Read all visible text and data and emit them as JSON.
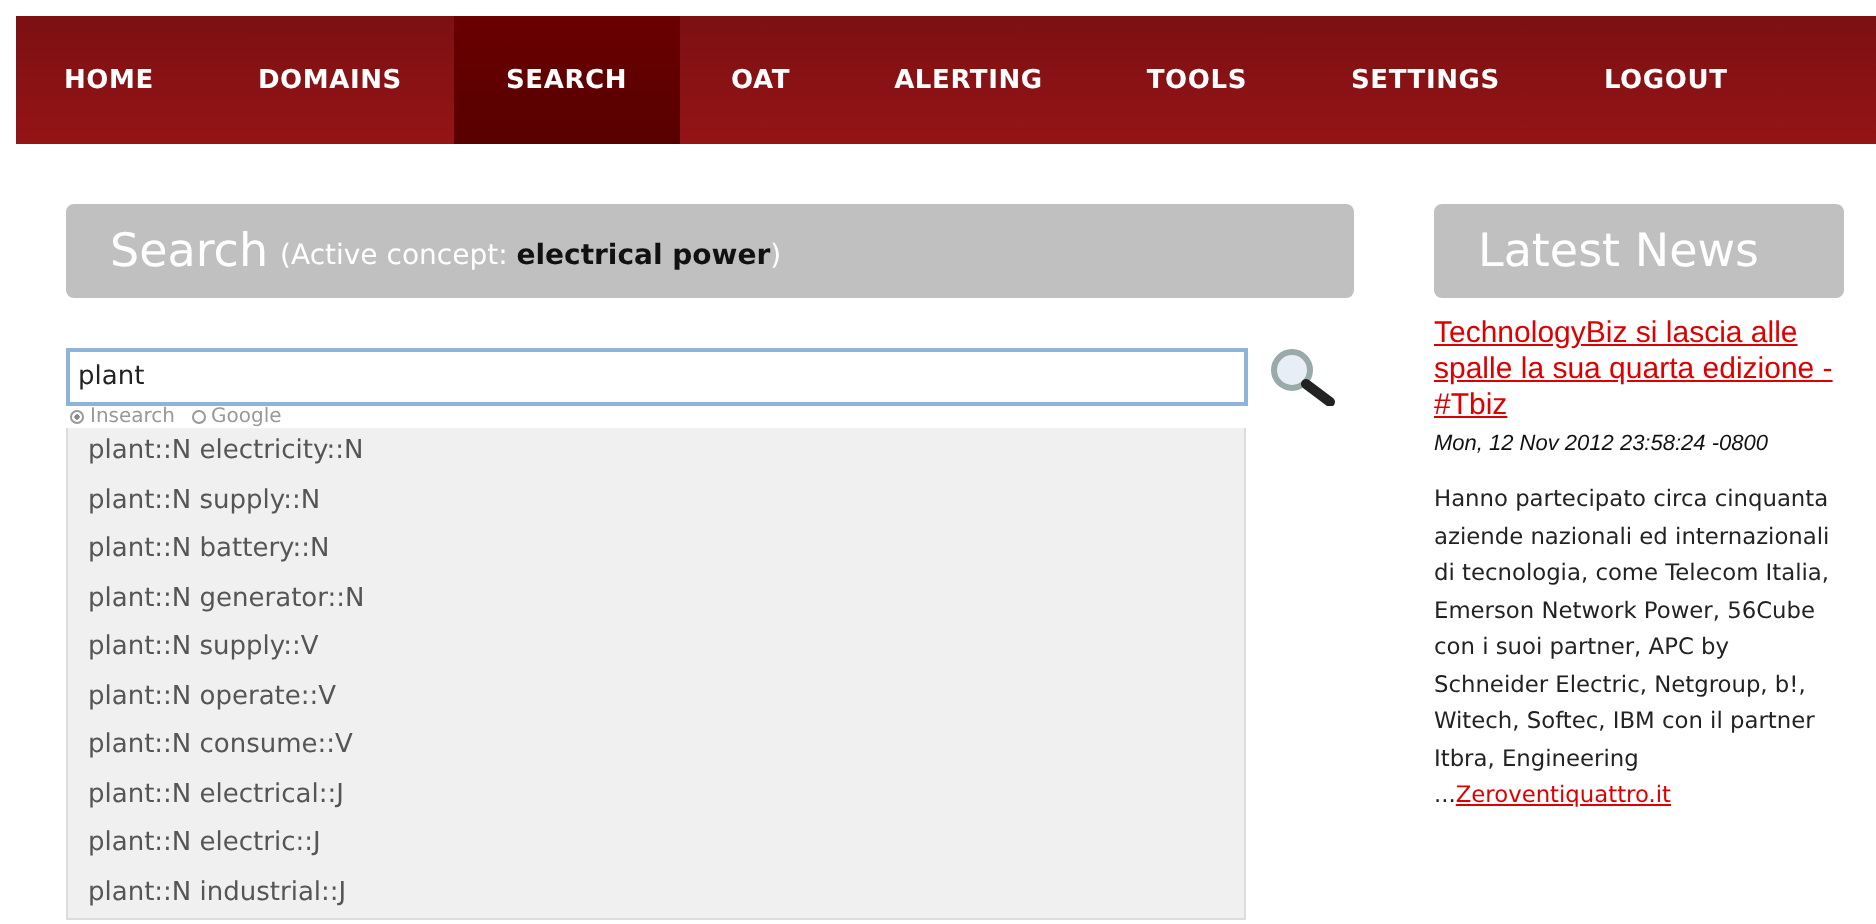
{
  "nav": [
    {
      "label": "HOME",
      "selected": false
    },
    {
      "label": "DOMAINS",
      "selected": false
    },
    {
      "label": "SEARCH",
      "selected": true
    },
    {
      "label": "OAT",
      "selected": false
    },
    {
      "label": "ALERTING",
      "selected": false
    },
    {
      "label": "TOOLS",
      "selected": false
    },
    {
      "label": "SETTINGS",
      "selected": false
    },
    {
      "label": "LOGOUT",
      "selected": false
    }
  ],
  "search": {
    "title": "Search",
    "subtitle": "(Active concept: **electrical power**)",
    "value": "plant",
    "engines": [
      {
        "label": "Insearch",
        "selected": true
      },
      {
        "label": "Google",
        "selected": false
      }
    ],
    "suggestions": [
      "plant::N electricity::N",
      "plant::N supply::N",
      "plant::N battery::N",
      "plant::N generator::N",
      "plant::N supply::V",
      "plant::N operate::V",
      "plant::N consume::V",
      "plant::N electrical::J",
      "plant::N electric::J",
      "plant::N industrial::J"
    ]
  },
  "news": {
    "title": "Latest News",
    "headline": "TechnologyBiz si lascia alle spalle la sua quarta edizione - #Tbiz",
    "date": "Mon, 12 Nov 2012 23:58:24 -0800",
    "body": "Hanno partecipato circa cinquanta aziende nazionali ed internazionali di tecnologia, come Telecom Italia, Emerson Network Power, 56Cube con i suoi partner, APC by Schneider Electric, Netgroup, b!, Witech, Softec, IBM con il partner Itbra, Engineering ...",
    "link": "Zeroventiquattro.it"
  }
}
